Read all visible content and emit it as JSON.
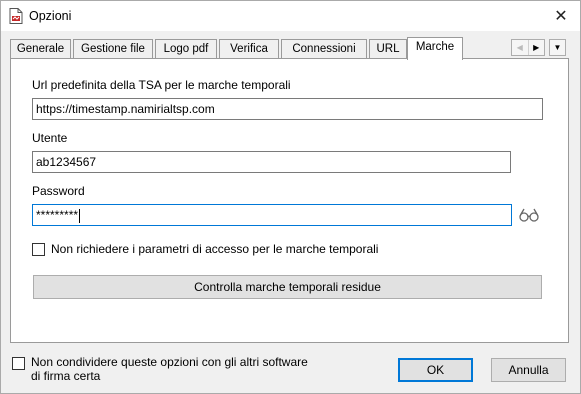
{
  "window": {
    "title": "Opzioni",
    "close_glyph": "✕"
  },
  "tabs": [
    {
      "label": "Generale",
      "active": false
    },
    {
      "label": "Gestione file",
      "active": false
    },
    {
      "label": "Logo pdf",
      "active": false
    },
    {
      "label": "Verifica",
      "active": false
    },
    {
      "label": "Connessioni",
      "active": false
    },
    {
      "label": "URL",
      "active": false
    },
    {
      "label": "Marche",
      "active": true
    }
  ],
  "tab_nav": {
    "scroll_left_glyph": "◀",
    "scroll_right_glyph": "▶",
    "dropdown_glyph": "▼"
  },
  "form": {
    "tsa_url_label": "Url predefinita della TSA per le marche temporali",
    "tsa_url_value": "https://timestamp.namirialtsp.com",
    "user_label": "Utente",
    "user_value": "ab1234567",
    "password_label": "Password",
    "password_value": "*********",
    "reveal_icon": "glasses-icon",
    "no_credentials_label": "Non richiedere i parametri di accesso per le marche temporali",
    "no_credentials_checked": false,
    "check_button_label": "Controlla marche temporali residue"
  },
  "footer": {
    "no_share_line1": "Non condividere queste opzioni con gli altri software",
    "no_share_line2": "di firma certa",
    "no_share_checked": false,
    "ok_label": "OK",
    "cancel_label": "Annulla"
  },
  "colors": {
    "focus_border": "#0078d7",
    "button_face": "#e1e1e1",
    "panel_bg": "#ffffff",
    "window_bg": "#f0f0f0"
  }
}
